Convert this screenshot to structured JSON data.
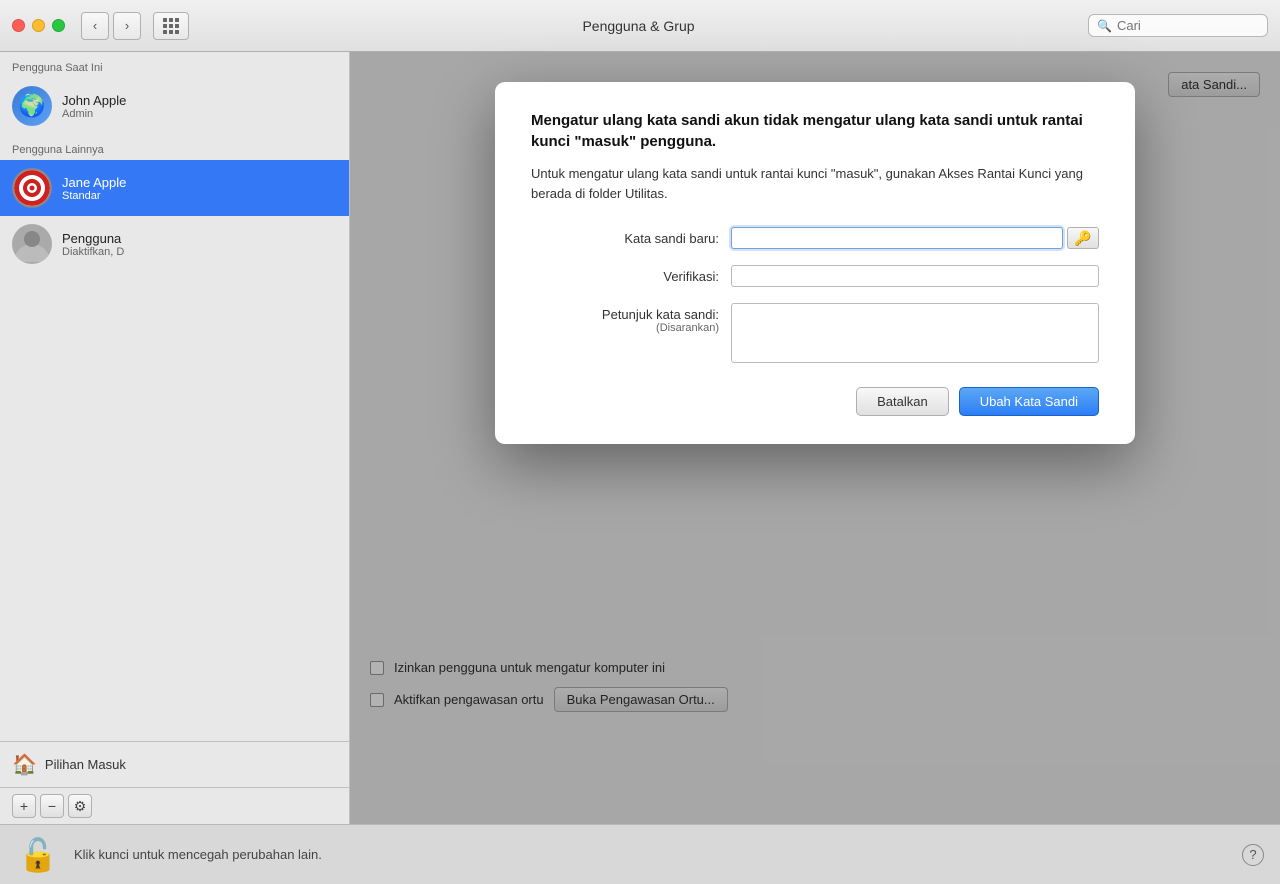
{
  "titleBar": {
    "title": "Pengguna & Grup",
    "searchPlaceholder": "Cari"
  },
  "sidebar": {
    "currentUsersLabel": "Pengguna Saat Ini",
    "otherUsersLabel": "Pengguna Lainnya",
    "currentUsers": [
      {
        "name": "John Apple",
        "role": "Admin",
        "avatarType": "globe"
      }
    ],
    "otherUsers": [
      {
        "name": "Jane Apple",
        "role": "Standar",
        "avatarType": "archery",
        "selected": true
      },
      {
        "name": "Pengguna",
        "role": "Diaktifkan, D",
        "avatarType": "person"
      }
    ],
    "loginOptionsLabel": "Pilihan Masuk",
    "addButton": "+",
    "removeButton": "−",
    "settingsButton": "⚙"
  },
  "content": {
    "allowAdminCheck": "Izinkan pengguna untuk mengatur komputer ini",
    "parentalCheck": "Aktifkan pengawasan ortu",
    "parentalButton": "Buka Pengawasan Ortu...",
    "changePasswordButton": "ata Sandi..."
  },
  "modal": {
    "title": "Mengatur ulang kata sandi akun tidak mengatur ulang kata sandi untuk rantai kunci \"masuk\" pengguna.",
    "description": "Untuk mengatur ulang kata sandi untuk rantai kunci \"masuk\", gunakan Akses Rantai Kunci yang berada di folder Utilitas.",
    "newPasswordLabel": "Kata sandi baru:",
    "verifyLabel": "Verifikasi:",
    "hintLabel": "Petunjuk kata sandi:",
    "hintSubLabel": "(Disarankan)",
    "cancelButton": "Batalkan",
    "changeButton": "Ubah Kata Sandi"
  },
  "bottomBar": {
    "text": "Klik kunci untuk mencegah perubahan lain.",
    "helpLabel": "?"
  }
}
